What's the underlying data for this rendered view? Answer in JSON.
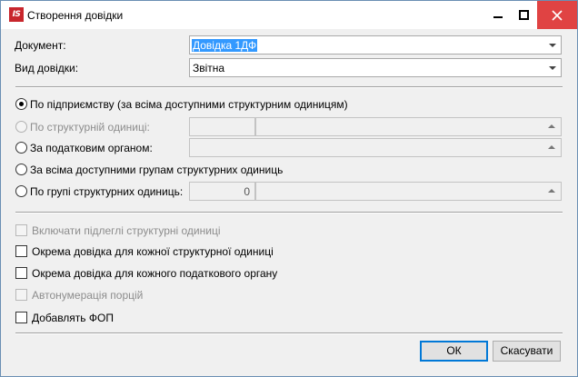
{
  "window": {
    "title": "Створення довідки",
    "logo_text": "IS",
    "controls": {
      "minimize_icon": "minimize-icon",
      "maximize_icon": "maximize-icon",
      "close_icon": "close-icon"
    }
  },
  "form": {
    "document": {
      "label": "Документ:",
      "value": "Довідка 1ДФ"
    },
    "kind": {
      "label": "Вид довідки:",
      "value": "Звітна"
    }
  },
  "scope": {
    "options": [
      {
        "label": "По підприємству (за всіма доступними структурним одиницям)",
        "selected": true,
        "enabled": true
      },
      {
        "label": "По структурній одиниці:",
        "selected": false,
        "enabled": false
      },
      {
        "label": "За податковим органом:",
        "selected": false,
        "enabled": true
      },
      {
        "label": "За всіма доступними групам структурних одиниць",
        "selected": false,
        "enabled": true
      },
      {
        "label": "По групі структурних одиниць:",
        "selected": false,
        "enabled": true
      }
    ],
    "group_number": "0"
  },
  "checkboxes": [
    {
      "label": "Включати підлеглі структурні одиниці",
      "checked": false,
      "enabled": false
    },
    {
      "label": "Окрема довідка для кожної структурної одиниці",
      "checked": false,
      "enabled": true
    },
    {
      "label": "Окрема довідка для кожного податкового органу",
      "checked": false,
      "enabled": true
    },
    {
      "label": "Автонумерація порцій",
      "checked": false,
      "enabled": false
    },
    {
      "label": "Добавлять ФОП",
      "checked": false,
      "enabled": true
    }
  ],
  "buttons": {
    "ok": "ОК",
    "cancel": "Скасувати"
  },
  "colors": {
    "accent": "#0078d7",
    "selection": "#3399ff",
    "close_hover": "#e04343",
    "logo": "#c8262c"
  }
}
